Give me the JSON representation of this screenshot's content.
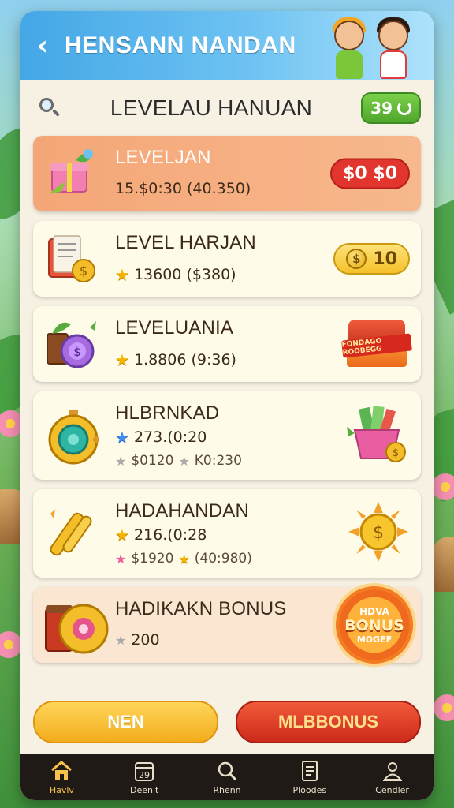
{
  "header": {
    "title": "HENSANN NANDAN",
    "back_icon": "chevron-left-icon"
  },
  "toolbar": {
    "page_title": "LEVELAU HANUAN",
    "level_value": "39"
  },
  "cards": [
    {
      "title": "LEVELJAN",
      "sub": "15.$0:30  (40.350)",
      "badge": "$0  $0",
      "icon": "gift-box-icon"
    },
    {
      "title": "LEVEL HARJAN",
      "sub": "13600  ($380)",
      "badge": "10",
      "icon": "notepad-coin-icon"
    },
    {
      "title": "LEVELUANIA",
      "sub": "1.8806  (9:36)",
      "chest_label": "FONDAGO ROOBEGG",
      "icon": "coin-plant-icon"
    },
    {
      "title": "HLBRNKAD",
      "sub": "273.(0:20",
      "sub2a": "$0120",
      "sub2b": "K0:230",
      "icon": "stopwatch-icon"
    },
    {
      "title": "HADAHANDAN",
      "sub": "216.(0:28",
      "sub2a": "$1920",
      "sub2b": "(40:980)",
      "icon": "golden-sticks-icon"
    },
    {
      "title": "HADIKAKN BONUS",
      "sub": "200",
      "icon": "treasure-chest-icon",
      "burst": {
        "line1": "HDVA",
        "line2": "BONUS",
        "line3": "MOGEF"
      }
    }
  ],
  "actions": {
    "left_label": "NEN",
    "right_label": "MLBBONUS"
  },
  "tabs": [
    {
      "label": "Havlv",
      "icon": "home-icon"
    },
    {
      "label": "Deenit",
      "icon": "calendar-icon"
    },
    {
      "label": "Rhenn",
      "icon": "search-icon"
    },
    {
      "label": "Ploodes",
      "icon": "document-icon"
    },
    {
      "label": "Cendler",
      "icon": "profile-icon"
    }
  ],
  "colors": {
    "header": "#44a7e6",
    "accent_orange": "#f5a677",
    "badge_green": "#4fa62b",
    "button_yellow": "#f2ac1d",
    "button_red": "#cc2a1a"
  }
}
